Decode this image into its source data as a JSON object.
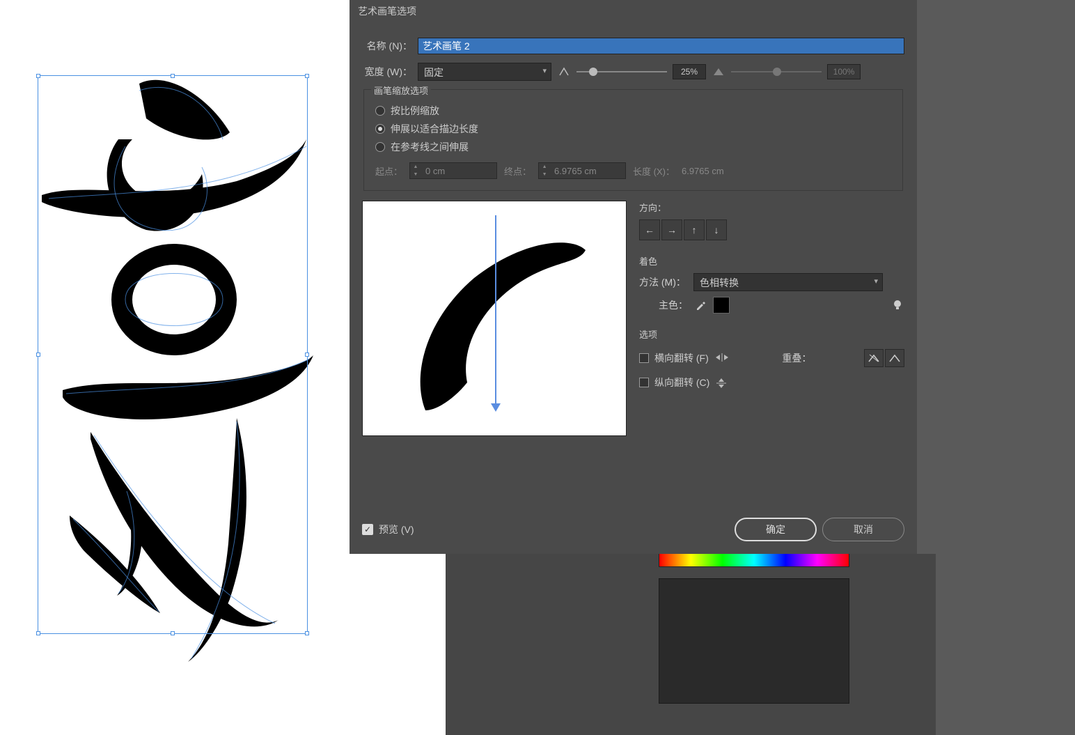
{
  "dialog": {
    "title": "艺术画笔选项",
    "name_label": "名称 (N)：",
    "name_value": "艺术画笔 2",
    "width_label": "宽度 (W)：",
    "width_mode": "固定",
    "width_pct": "25%",
    "width_pct2": "100%"
  },
  "scale": {
    "group_title": "画笔缩放选项",
    "opt1": "按比例缩放",
    "opt2": "伸展以适合描边长度",
    "opt3": "在参考线之间伸展",
    "start_label": "起点：",
    "start_value": "0 cm",
    "end_label": "终点：",
    "end_value": "6.9765 cm",
    "length_label": "长度 (X)：",
    "length_value": "6.9765 cm"
  },
  "direction": {
    "heading": "方向："
  },
  "colorize": {
    "heading": "着色",
    "method_label": "方法 (M)：",
    "method_value": "色相转换",
    "keycolor_label": "主色："
  },
  "options": {
    "heading": "选项",
    "flip_h": "横向翻转 (F)",
    "flip_v": "纵向翻转 (C)",
    "overlap_label": "重叠："
  },
  "footer": {
    "preview": "预览 (V)",
    "ok": "确定",
    "cancel": "取消"
  }
}
